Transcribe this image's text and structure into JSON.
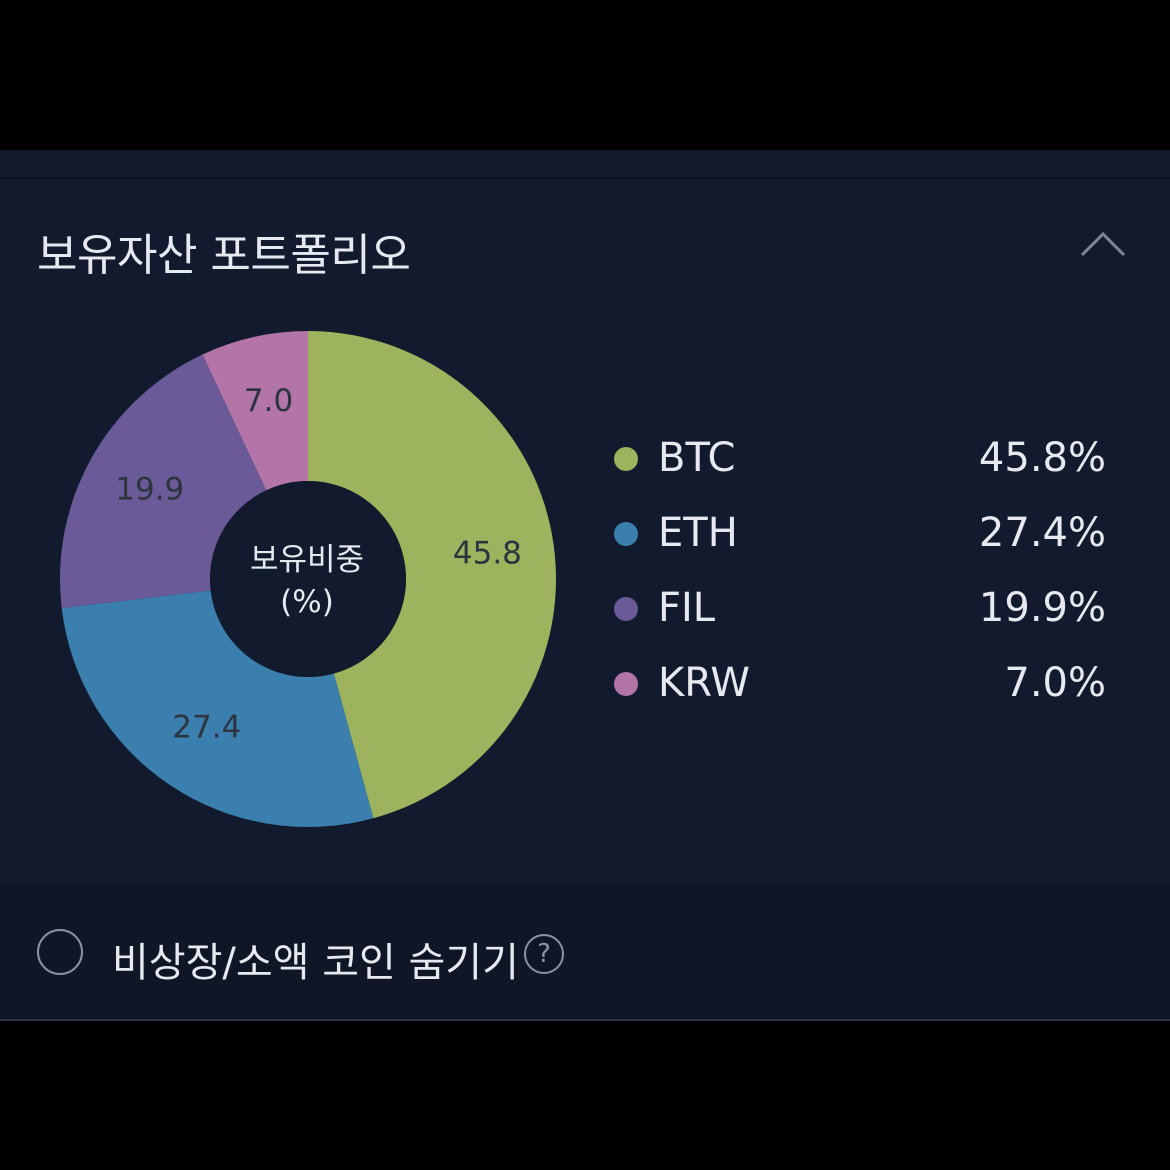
{
  "header": {
    "title": "보유자산 포트폴리오",
    "collapse_icon": "chevron-up-icon"
  },
  "chart_data": {
    "type": "pie",
    "center_label_line1": "보유비중",
    "center_label_line2": "(%)",
    "categories": [
      "BTC",
      "ETH",
      "FIL",
      "KRW"
    ],
    "values": [
      45.8,
      27.4,
      19.9,
      7.0
    ],
    "slice_labels": [
      "45.8",
      "27.4",
      "19.9",
      "7.0"
    ],
    "colors": [
      "#9db35e",
      "#3a7fad",
      "#6a5a98",
      "#b374a8"
    ],
    "legend": [
      {
        "name": "BTC",
        "value": "45.8%"
      },
      {
        "name": "ETH",
        "value": "27.4%"
      },
      {
        "name": "FIL",
        "value": "19.9%"
      },
      {
        "name": "KRW",
        "value": "7.0%"
      }
    ]
  },
  "footer": {
    "label": "비상장/소액 코인 숨기기",
    "help_icon": "question-circle-icon",
    "help_glyph": "?"
  }
}
